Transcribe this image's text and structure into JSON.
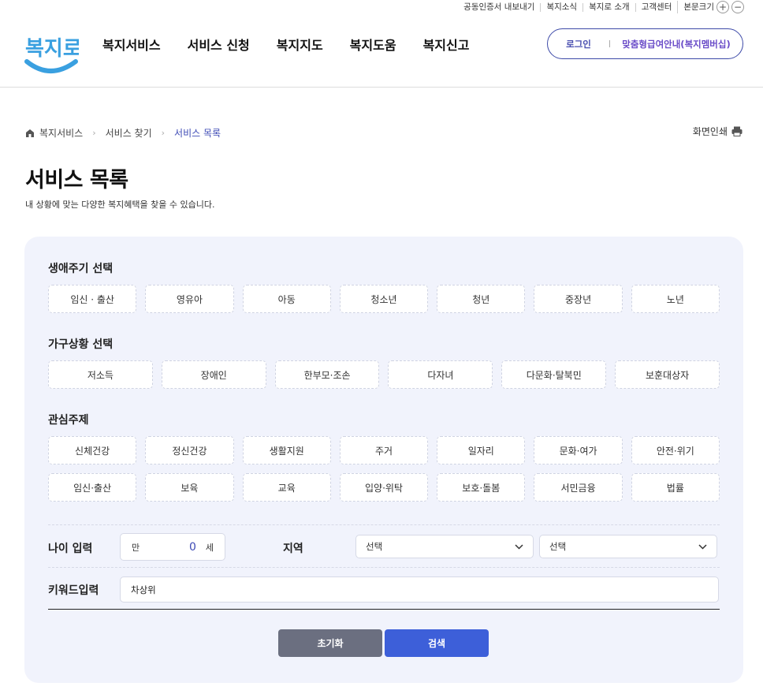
{
  "utility": {
    "links": [
      "공동인증서 내보내기",
      "복지소식",
      "복지로 소개",
      "고객센터"
    ],
    "font_size_label": "본문크기",
    "plus": "+",
    "minus": "−"
  },
  "logo_text": "복지로",
  "gnb": [
    "복지서비스",
    "서비스 신청",
    "복지지도",
    "복지도움",
    "복지신고"
  ],
  "login": {
    "login_label": "로그인",
    "membership_label": "맞춤형급여안내(복지멤버십)"
  },
  "breadcrumb": [
    "복지서비스",
    "서비스 찾기",
    "서비스 목록"
  ],
  "print_label": "화면인쇄",
  "page": {
    "title": "서비스 목록",
    "description": "내 상황에 맞는 다양한 복지혜택을 찾을 수 있습니다."
  },
  "lifecycle": {
    "heading": "생애주기 선택",
    "items": [
      "임신 · 출산",
      "영유아",
      "아동",
      "청소년",
      "청년",
      "중장년",
      "노년"
    ]
  },
  "household": {
    "heading": "가구상황 선택",
    "items": [
      "저소득",
      "장애인",
      "한부모·조손",
      "다자녀",
      "다문화·탈북민",
      "보훈대상자"
    ]
  },
  "interest": {
    "heading": "관심주제",
    "items": [
      "신체건강",
      "정신건강",
      "생활지원",
      "주거",
      "일자리",
      "문화·여가",
      "안전·위기",
      "임신·출산",
      "보육",
      "교육",
      "입양·위탁",
      "보호·돌봄",
      "서민금융",
      "법률"
    ]
  },
  "age": {
    "label": "나이 입력",
    "prefix": "만",
    "value": "0",
    "suffix": "세"
  },
  "region": {
    "label": "지역",
    "select1": "선택",
    "select2": "선택"
  },
  "keyword": {
    "label": "키워드입력",
    "value": "차상위"
  },
  "buttons": {
    "reset": "초기화",
    "search": "검색"
  },
  "colors": {
    "accent": "#3d5fd9",
    "panel_bg": "#f1f3fc",
    "reset_btn": "#6b6f80",
    "logo_blue": "#3aa0e0"
  }
}
